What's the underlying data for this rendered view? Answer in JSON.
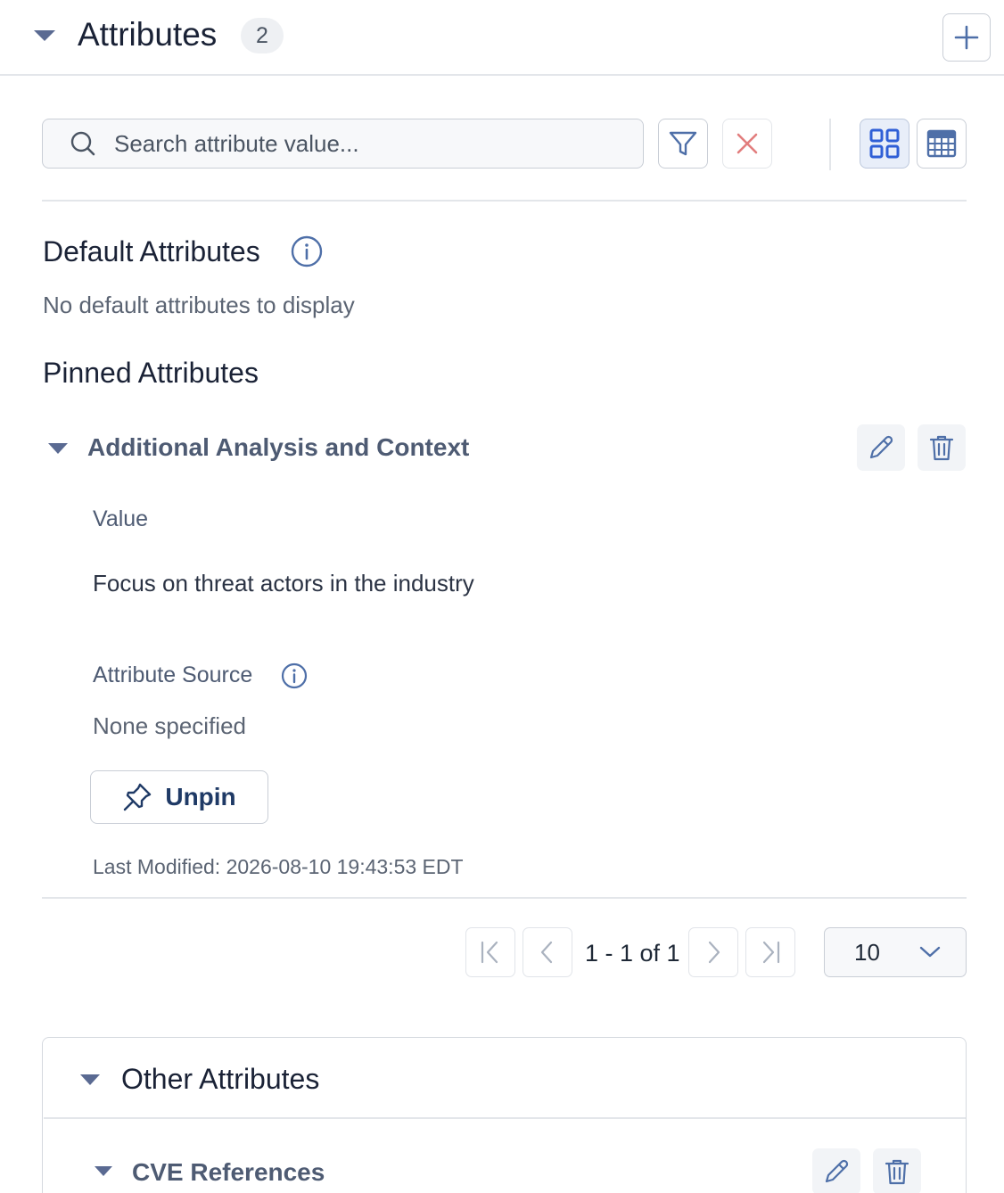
{
  "header": {
    "title": "Attributes",
    "count": "2",
    "add_icon": "plus-icon"
  },
  "toolbar": {
    "search_placeholder": "Search attribute value...",
    "search_value": "",
    "filter_icon": "filter-icon",
    "clear_icon": "close-icon",
    "view_modes": [
      "grid-view-icon",
      "table-view-icon"
    ],
    "active_view": "grid"
  },
  "default_section": {
    "title": "Default Attributes",
    "empty_text": "No default attributes to display"
  },
  "pinned_section": {
    "title": "Pinned Attributes",
    "group": {
      "title": "Additional Analysis and Context",
      "value_label": "Value",
      "value": "Focus on threat actors in the industry",
      "source_label": "Attribute Source",
      "source_value": "None specified",
      "unpin_label": "Unpin",
      "last_modified": "Last Modified: 2026-08-10 19:43:53 EDT"
    }
  },
  "pagination": {
    "range_text": "1 - 1 of 1",
    "page_size": "10"
  },
  "other_section": {
    "title": "Other Attributes",
    "first_group": "CVE References"
  },
  "colors": {
    "accent": "#2f5fd6",
    "clear_red": "#e27d7d",
    "muted_text": "#4e5b73",
    "border": "#c9ced6"
  }
}
